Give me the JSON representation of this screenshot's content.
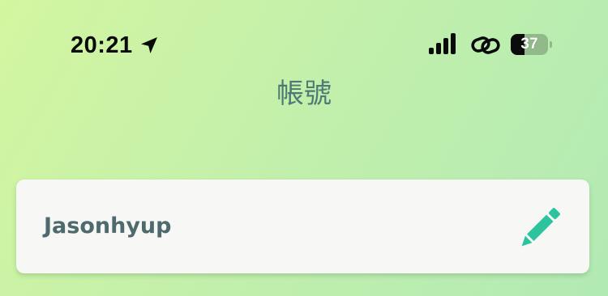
{
  "status_bar": {
    "time": "20:21",
    "battery_level": "37",
    "battery_fraction": 0.37,
    "icons": {
      "location": "location-arrow-icon",
      "signal": "cellular-signal-icon",
      "link": "personal-hotspot-link-icon",
      "battery": "battery-icon"
    }
  },
  "header": {
    "title": "帳號"
  },
  "account": {
    "username": "Jasonhyup",
    "edit_icon": "pencil-icon"
  },
  "colors": {
    "title": "#4d7a74",
    "username": "#4f6a6c",
    "accent": "#2cc39f",
    "card_background": "#f7f8f5"
  }
}
